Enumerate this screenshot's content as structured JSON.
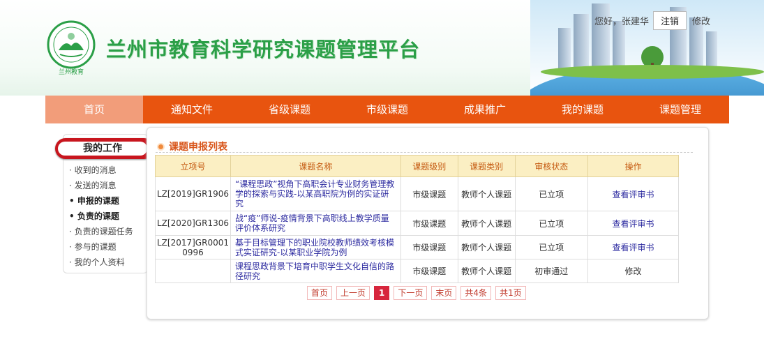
{
  "header": {
    "site_title": "兰州市教育科学研究课题管理平台",
    "logo_text": "LANZHOU EDUCATION",
    "logo_sub": "兰州教育",
    "greeting": "您好，张建华",
    "logout_label": "注销",
    "modify_label": "修改"
  },
  "nav": {
    "items": [
      {
        "label": "首页"
      },
      {
        "label": "通知文件"
      },
      {
        "label": "省级课题"
      },
      {
        "label": "市级课题"
      },
      {
        "label": "成果推广"
      },
      {
        "label": "我的课题"
      },
      {
        "label": "课题管理"
      }
    ]
  },
  "sidebar": {
    "title": "我的工作",
    "items": [
      {
        "label": "· 收到的消息"
      },
      {
        "label": "· 发送的消息"
      },
      {
        "label": "• 申报的课题"
      },
      {
        "label": "• 负责的课题"
      },
      {
        "label": "· 负责的课题任务"
      },
      {
        "label": "· 参与的课题"
      },
      {
        "label": "· 我的个人资料"
      }
    ]
  },
  "main": {
    "title": "课题申报列表",
    "columns": [
      "立项号",
      "课题名称",
      "课题级别",
      "课题类别",
      "审核状态",
      "操作"
    ],
    "rows": [
      {
        "id": "LZ[2019]GR1906",
        "name": "“课程思政”视角下高职会计专业财务管理教学的探索与实践-以某高职院为例的实证研究",
        "level": "市级课题",
        "category": "教师个人课题",
        "status": "已立项",
        "action": "查看评审书"
      },
      {
        "id": "LZ[2020]GR1306",
        "name": "战“疫”师说-疫情背景下高职线上教学质量评价体系研究",
        "level": "市级课题",
        "category": "教师个人课题",
        "status": "已立项",
        "action": "查看评审书"
      },
      {
        "id": "LZ[2017]GR00010996",
        "name": "基于目标管理下的职业院校教师绩效考核模式实证研究-以某职业学院为例",
        "level": "市级课题",
        "category": "教师个人课题",
        "status": "已立项",
        "action": "查看评审书"
      },
      {
        "id": "",
        "name": "课程思政背景下培育中职学生文化自信的路径研究",
        "level": "市级课题",
        "category": "教师个人课题",
        "status": "初审通过",
        "action": "修改"
      }
    ]
  },
  "pager": {
    "first": "首页",
    "prev": "上一页",
    "current": "1",
    "next": "下一页",
    "last": "末页",
    "total": "共4条",
    "pages": "共1页"
  }
}
